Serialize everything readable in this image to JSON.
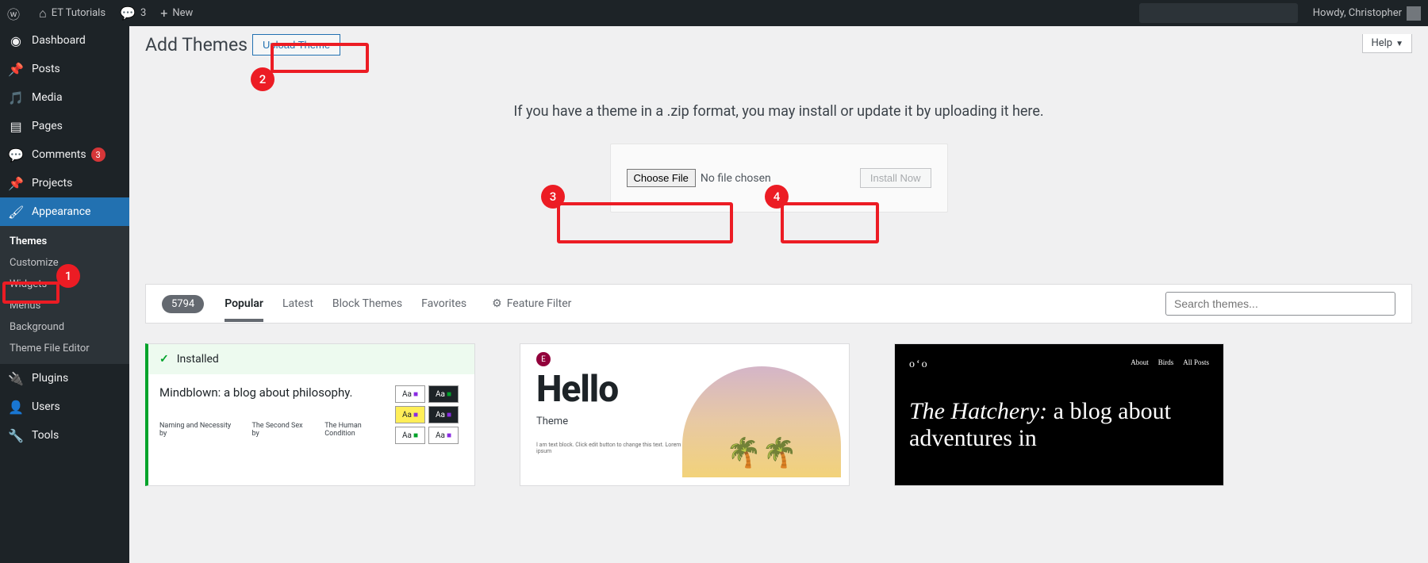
{
  "adminbar": {
    "site_name": "ET Tutorials",
    "comments_count": "3",
    "new_label": "New",
    "howdy": "Howdy, Christopher"
  },
  "sidebar": {
    "items": [
      {
        "label": "Dashboard",
        "icon": "dash"
      },
      {
        "label": "Posts",
        "icon": "pin"
      },
      {
        "label": "Media",
        "icon": "media"
      },
      {
        "label": "Pages",
        "icon": "page"
      },
      {
        "label": "Comments",
        "icon": "comment",
        "badge": "3"
      },
      {
        "label": "Projects",
        "icon": "pin"
      },
      {
        "label": "Appearance",
        "icon": "brush",
        "current": true
      },
      {
        "label": "Plugins",
        "icon": "plug"
      },
      {
        "label": "Users",
        "icon": "users"
      },
      {
        "label": "Tools",
        "icon": "tools"
      }
    ],
    "submenu": [
      {
        "label": "Themes",
        "current": true
      },
      {
        "label": "Customize"
      },
      {
        "label": "Widgets"
      },
      {
        "label": "Menus"
      },
      {
        "label": "Background"
      },
      {
        "label": "Theme File Editor"
      }
    ]
  },
  "page": {
    "title": "Add Themes",
    "upload_button": "Upload Theme",
    "help": "Help",
    "upload_instruction": "If you have a theme in a .zip format, you may install or update it by uploading it here.",
    "choose_file": "Choose File",
    "no_file": "No file chosen",
    "install_now": "Install Now"
  },
  "filter": {
    "count": "5794",
    "tabs": [
      "Popular",
      "Latest",
      "Block Themes",
      "Favorites"
    ],
    "feature_filter": "Feature Filter",
    "search_placeholder": "Search themes..."
  },
  "themes": {
    "card1": {
      "installed_label": "Installed",
      "heading": "Mindblown: a blog about philosophy.",
      "col1": "Naming and Necessity by",
      "col2": "The Second Sex by",
      "col3": "The Human Condition",
      "swatch_text": "Aa"
    },
    "card2": {
      "title": "Hello",
      "subtitle": "Theme",
      "desc": "I am text block. Click edit button to change this text. Lorem ipsum"
    },
    "card3": {
      "nav": [
        "About",
        "Birds",
        "All Posts"
      ],
      "logo": "oʻo",
      "title_em": "The Hatchery:",
      "title_rest": " a blog about adventures in"
    }
  },
  "annotations": {
    "n1": "1",
    "n2": "2",
    "n3": "3",
    "n4": "4"
  }
}
